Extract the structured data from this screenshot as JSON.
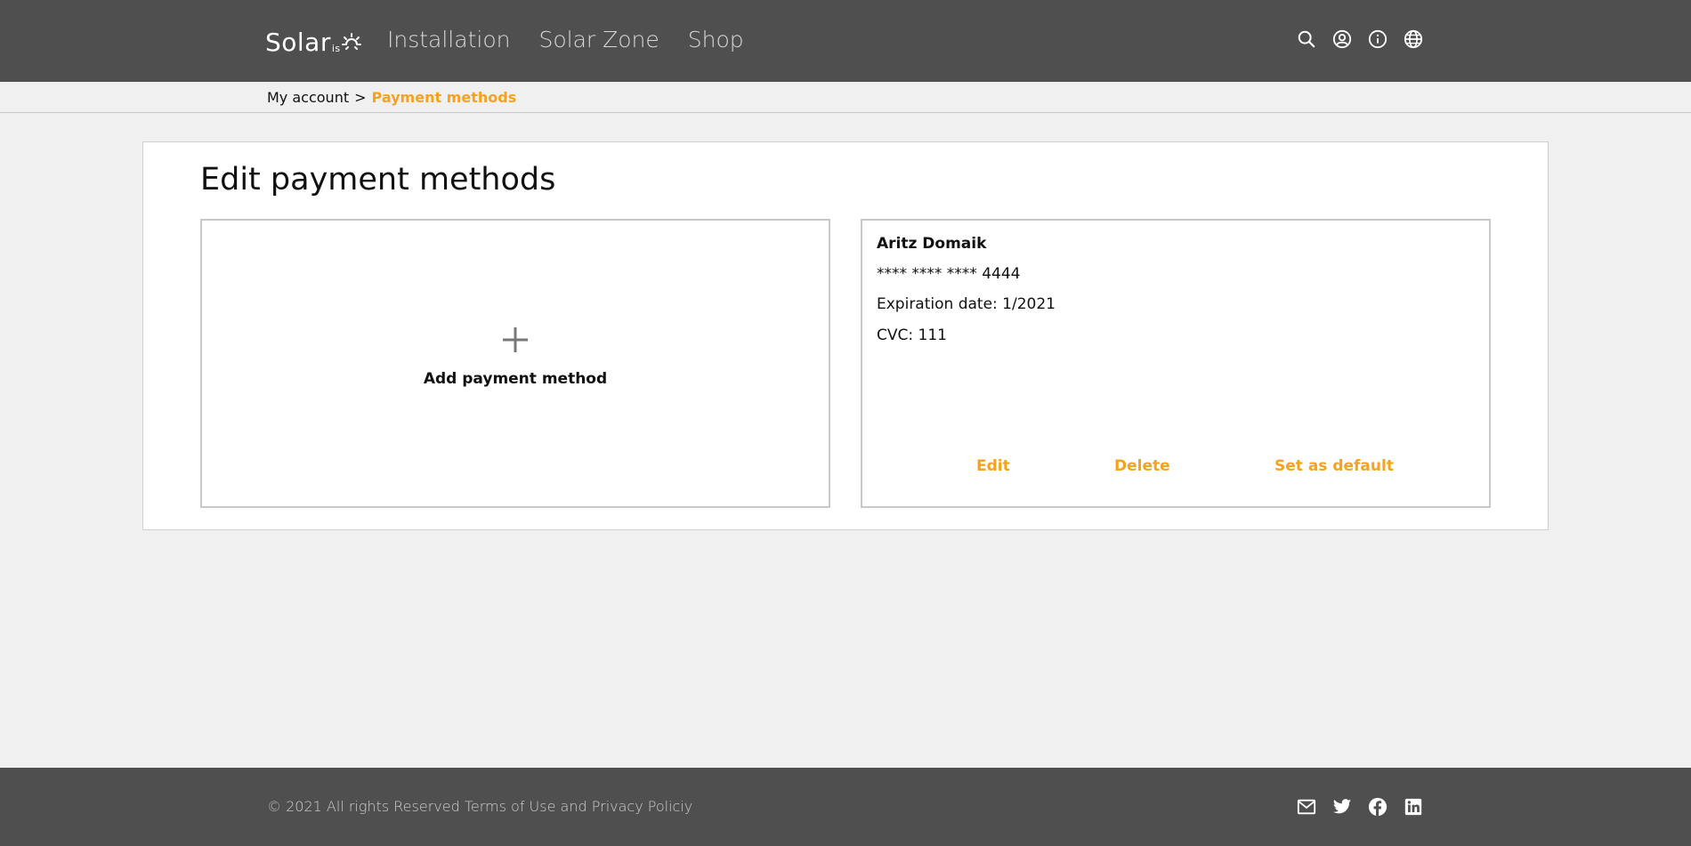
{
  "header": {
    "logo": {
      "word": "Solar",
      "sub": "is"
    },
    "nav": [
      "Installation",
      "Solar Zone",
      "Shop"
    ],
    "icons": [
      "search-icon",
      "account-icon",
      "info-icon",
      "globe-icon"
    ]
  },
  "breadcrumb": {
    "parent": "My account",
    "separator": ">",
    "current": "Payment methods"
  },
  "main": {
    "title": "Edit payment methods",
    "add_card": {
      "label": "Add payment method",
      "icon": "plus-icon"
    },
    "payment_method": {
      "holder": "Aritz Domaik",
      "number": "**** **** **** 4444",
      "expiration": "Expiration date: 1/2021",
      "cvc": "CVC: 111",
      "actions": {
        "edit": "Edit",
        "delete": "Delete",
        "set_default": "Set as default"
      }
    }
  },
  "footer": {
    "copyright": "© 2021 All rights Reserved",
    "terms": "Terms of Use",
    "and": "and",
    "privacy": "Privacy Policiy",
    "icons": [
      "mail-icon",
      "twitter-icon",
      "facebook-icon",
      "linkedin-icon"
    ]
  },
  "colors": {
    "header_bg": "#4f4f4f",
    "accent": "#f5a21e",
    "page_bg": "#f0f0f0"
  }
}
